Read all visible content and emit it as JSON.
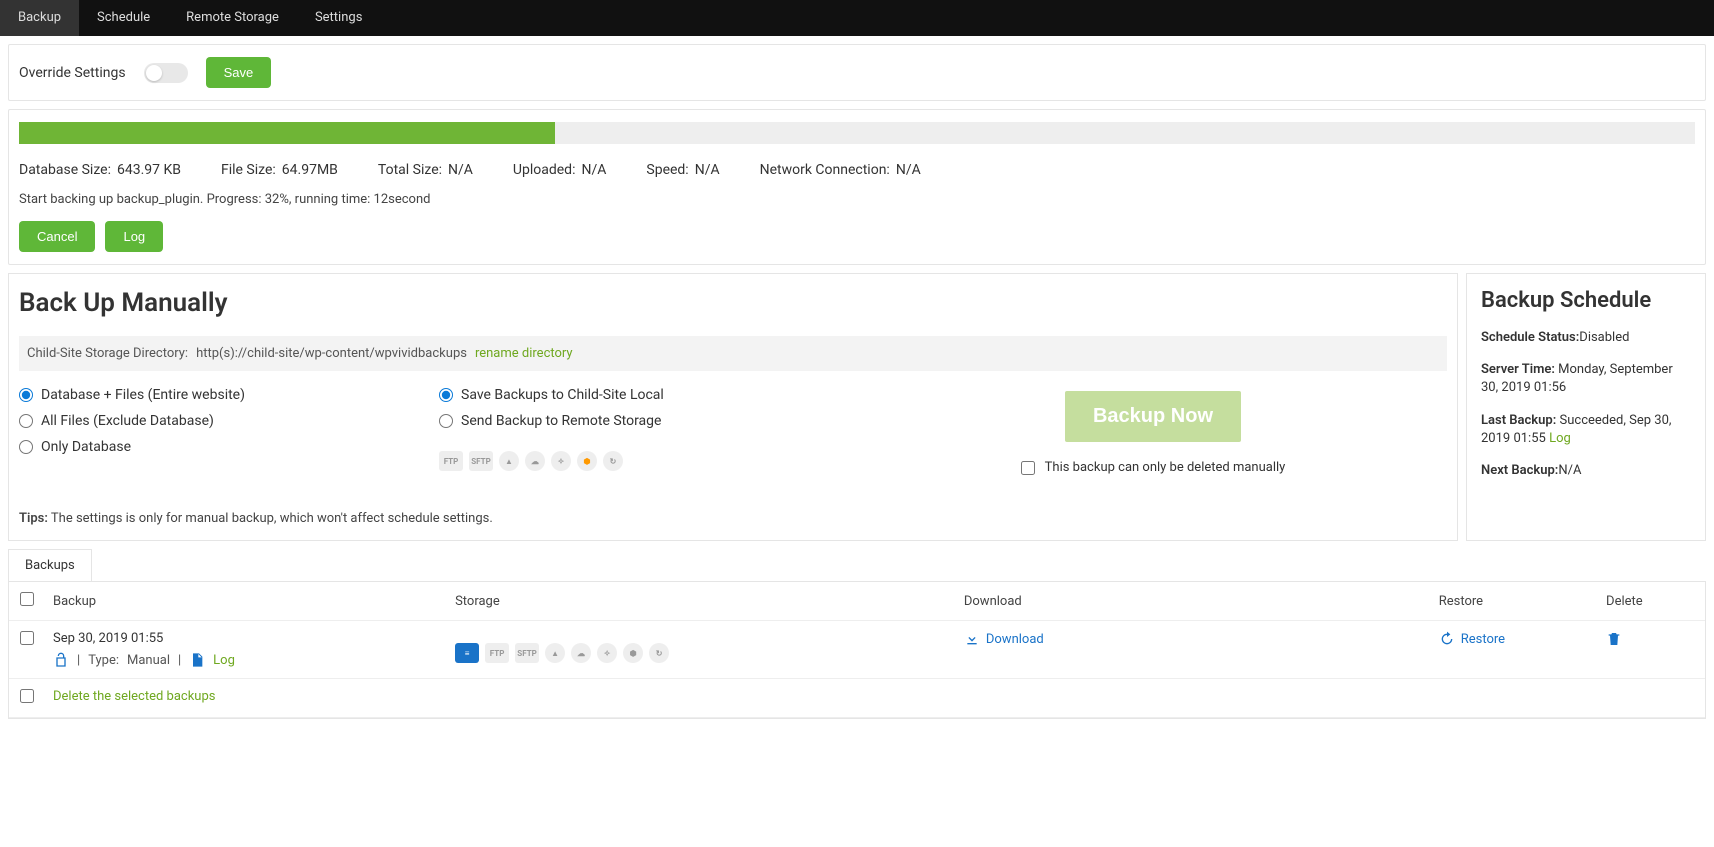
{
  "nav": {
    "tabs": [
      "Backup",
      "Schedule",
      "Remote Storage",
      "Settings"
    ],
    "active": 0
  },
  "override": {
    "label": "Override Settings",
    "save": "Save"
  },
  "progress": {
    "percent": 32,
    "stats": {
      "db_label": "Database Size:",
      "db_val": "643.97 KB",
      "file_label": "File Size:",
      "file_val": "64.97MB",
      "total_label": "Total Size:",
      "total_val": "N/A",
      "up_label": "Uploaded:",
      "up_val": "N/A",
      "speed_label": "Speed:",
      "speed_val": "N/A",
      "net_label": "Network Connection:",
      "net_val": "N/A"
    },
    "status": "Start backing up backup_plugin. Progress: 32%, running time: 12second",
    "cancel": "Cancel",
    "log": "Log"
  },
  "manual": {
    "title": "Back Up Manually",
    "dir_label": "Child-Site Storage Directory:",
    "dir_path": "http(s)://child-site/wp-content/wpvividbackups",
    "rename": "rename directory",
    "what": {
      "o1": "Database + Files (Entire website)",
      "o2": "All Files (Exclude Database)",
      "o3": "Only Database"
    },
    "where": {
      "o1": "Save Backups to Child-Site Local",
      "o2": "Send Backup to Remote Storage"
    },
    "storage_types": [
      "FTP",
      "SFTP",
      "GDRIVE",
      "ONEDRIVE",
      "DROPBOX",
      "S3",
      "DO"
    ],
    "backup_now": "Backup Now",
    "manual_delete": "This backup can only be deleted manually",
    "tips_label": "Tips:",
    "tips_text": "The settings is only for manual backup, which won't affect schedule settings."
  },
  "schedule": {
    "title": "Backup Schedule",
    "status_label": "Schedule Status:",
    "status_val": "Disabled",
    "server_label": "Server Time:",
    "server_val": "Monday, September 30, 2019 01:56",
    "last_label": "Last Backup:",
    "last_val": "Succeeded, Sep 30, 2019 01:55",
    "last_link": "Log",
    "next_label": "Next Backup:",
    "next_val": "N/A"
  },
  "list": {
    "tab": "Backups",
    "cols": {
      "backup": "Backup",
      "storage": "Storage",
      "download": "Download",
      "restore": "Restore",
      "delete": "Delete"
    },
    "row": {
      "date": "Sep 30, 2019 01:55",
      "type_label": "Type:",
      "type_val": "Manual",
      "log": "Log",
      "download": "Download",
      "restore": "Restore"
    },
    "footer": "Delete the selected backups"
  }
}
